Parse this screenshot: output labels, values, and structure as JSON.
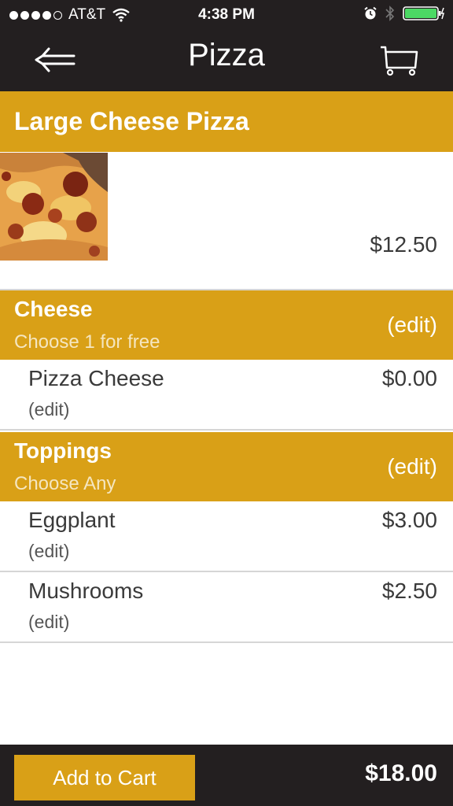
{
  "status_bar": {
    "carrier": "AT&T",
    "time": "4:38 PM"
  },
  "nav": {
    "title": "Pizza",
    "back_icon": "back-arrow-icon",
    "cart_icon": "cart-icon"
  },
  "item": {
    "title": "Large Cheese Pizza",
    "price": "$12.50",
    "image": "pizza-photo"
  },
  "groups": [
    {
      "title": "Cheese",
      "subtitle": "Choose 1 for free",
      "edit_label": "(edit)",
      "options": [
        {
          "name": "Pizza Cheese",
          "price": "$0.00",
          "edit_label": "(edit)"
        }
      ]
    },
    {
      "title": "Toppings",
      "subtitle": "Choose Any",
      "edit_label": "(edit)",
      "options": [
        {
          "name": "Eggplant",
          "price": "$3.00",
          "edit_label": "(edit)"
        },
        {
          "name": "Mushrooms",
          "price": "$2.50",
          "edit_label": "(edit)"
        }
      ]
    }
  ],
  "footer": {
    "add_to_cart_label": "Add to Cart",
    "total": "$18.00"
  },
  "colors": {
    "accent": "#d9a017",
    "bar": "#231f20",
    "battery": "#4cd964"
  }
}
